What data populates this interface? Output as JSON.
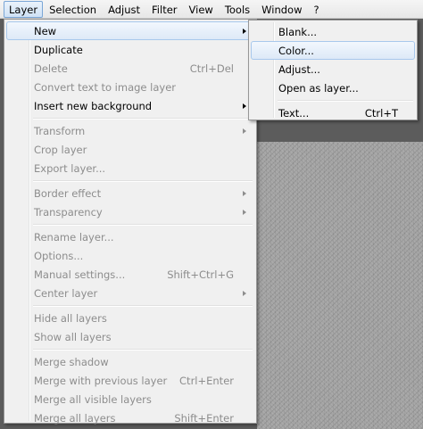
{
  "menubar": {
    "items": [
      {
        "label": "Layer",
        "active": true
      },
      {
        "label": "Selection"
      },
      {
        "label": "Adjust"
      },
      {
        "label": "Filter"
      },
      {
        "label": "View"
      },
      {
        "label": "Tools"
      },
      {
        "label": "Window"
      },
      {
        "label": "?"
      }
    ]
  },
  "layer_menu": {
    "groups": [
      [
        {
          "label": "New",
          "submenu": true,
          "highlight": true
        },
        {
          "label": "Duplicate"
        },
        {
          "label": "Delete",
          "shortcut": "Ctrl+Del",
          "disabled": true
        },
        {
          "label": "Convert text to image layer",
          "disabled": true
        },
        {
          "label": "Insert new background",
          "submenu": true
        }
      ],
      [
        {
          "label": "Transform",
          "submenu": true,
          "disabled": true
        },
        {
          "label": "Crop layer",
          "disabled": true
        },
        {
          "label": "Export layer...",
          "disabled": true
        }
      ],
      [
        {
          "label": "Border effect",
          "submenu": true,
          "disabled": true
        },
        {
          "label": "Transparency",
          "submenu": true,
          "disabled": true
        }
      ],
      [
        {
          "label": "Rename layer...",
          "disabled": true
        },
        {
          "label": "Options...",
          "disabled": true
        },
        {
          "label": "Manual settings...",
          "shortcut": "Shift+Ctrl+G",
          "disabled": true
        },
        {
          "label": "Center layer",
          "submenu": true,
          "disabled": true
        }
      ],
      [
        {
          "label": "Hide all layers",
          "disabled": true
        },
        {
          "label": "Show all layers",
          "disabled": true
        }
      ],
      [
        {
          "label": "Merge shadow",
          "disabled": true
        },
        {
          "label": "Merge with previous layer",
          "shortcut": "Ctrl+Enter",
          "disabled": true
        },
        {
          "label": "Merge all visible layers",
          "disabled": true
        },
        {
          "label": "Merge all layers",
          "shortcut": "Shift+Enter",
          "disabled": true
        }
      ]
    ]
  },
  "new_submenu": {
    "groups": [
      [
        {
          "label": "Blank..."
        },
        {
          "label": "Color...",
          "highlight": true
        },
        {
          "label": "Adjust..."
        },
        {
          "label": "Open as layer..."
        }
      ],
      [
        {
          "label": "Text...",
          "shortcut": "Ctrl+T"
        }
      ]
    ]
  }
}
